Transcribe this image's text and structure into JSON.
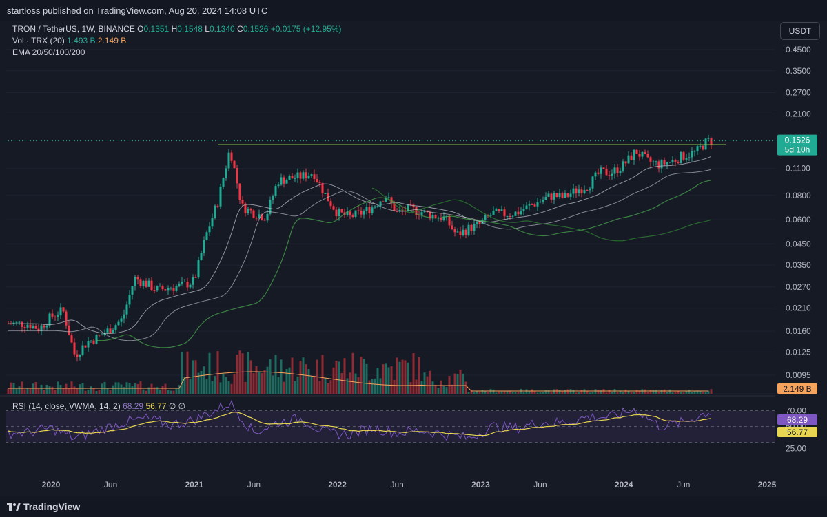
{
  "header": {
    "published": "startloss published on TradingView.com, Aug 20, 2024 14:08 UTC"
  },
  "legend": {
    "symbol": "TRON / TetherUS, 1W, BINANCE",
    "o_label": "O",
    "o_value": "0.1351",
    "h_label": "H",
    "h_value": "0.1548",
    "l_label": "L",
    "l_value": "0.1340",
    "c_label": "C",
    "c_value": "0.1526",
    "change": "+0.0175 (+12.95%)",
    "vol_label": "Vol · TRX (20)",
    "vol_value": "1.493 B",
    "vol_ma": "2.149 B",
    "ema": "EMA 20/50/100/200",
    "rsi_label": "RSI (14, close, VWMA, 14, 2)",
    "rsi_value": "68.29",
    "rsi_ma": "56.77",
    "rsi_extra1": "∅",
    "rsi_extra2": "∅"
  },
  "currency_button": "USDT",
  "footer": {
    "logo_text": "TradingView"
  },
  "colors": {
    "up": "#22ab94",
    "down": "#f23645",
    "ema20": "#b2b5be",
    "ema50": "#d1d4dc",
    "ema100": "#4caf50",
    "ema200": "#2e7d32",
    "rsi": "#7e57c2",
    "rsi_ma": "#e8d552",
    "resistance": "#8bc34a",
    "vol_ma": "#f7a35c"
  },
  "chart_data": {
    "type": "candlestick",
    "symbol": "TRON / TetherUS",
    "interval": "1W",
    "exchange": "BINANCE",
    "y_scale": "log",
    "price_ticks": [
      "0.4500",
      "0.3500",
      "0.2700",
      "0.2100",
      "0.1526",
      "0.1100",
      "0.0800",
      "0.0600",
      "0.0450",
      "0.0350",
      "0.0270",
      "0.0210",
      "0.0160",
      "0.0125",
      "0.0095"
    ],
    "x_ticks": [
      "2020",
      "Jun",
      "2021",
      "Jun",
      "2022",
      "Jun",
      "2023",
      "Jun",
      "2024",
      "Jun",
      "2025"
    ],
    "last_price": "0.1526",
    "countdown": "5d 10h",
    "volume_ma_label": "2.149 B",
    "resistance_level": 0.146,
    "rsi_ticks": [
      "70.00",
      "50.00",
      "25.00"
    ],
    "rsi_last": "68.29",
    "rsi_ma_last": "56.77",
    "series": [
      {
        "name": "price_close",
        "points": [
          [
            "2019-11",
            0.0175
          ],
          [
            "2019-12",
            0.0165
          ],
          [
            "2020-01",
            0.019
          ],
          [
            "2020-02",
            0.0205
          ],
          [
            "2020-03",
            0.012
          ],
          [
            "2020-04",
            0.014
          ],
          [
            "2020-05",
            0.015
          ],
          [
            "2020-06",
            0.0165
          ],
          [
            "2020-07",
            0.0185
          ],
          [
            "2020-08",
            0.03
          ],
          [
            "2020-09",
            0.028
          ],
          [
            "2020-10",
            0.026
          ],
          [
            "2020-11",
            0.027
          ],
          [
            "2020-12",
            0.0275
          ],
          [
            "2021-01",
            0.029
          ],
          [
            "2021-02",
            0.05
          ],
          [
            "2021-03",
            0.075
          ],
          [
            "2021-04",
            0.14
          ],
          [
            "2021-05",
            0.07
          ],
          [
            "2021-06",
            0.065
          ],
          [
            "2021-07",
            0.062
          ],
          [
            "2021-08",
            0.095
          ],
          [
            "2021-09",
            0.098
          ],
          [
            "2021-10",
            0.1
          ],
          [
            "2021-11",
            0.105
          ],
          [
            "2021-12",
            0.08
          ],
          [
            "2022-01",
            0.065
          ],
          [
            "2022-02",
            0.062
          ],
          [
            "2022-03",
            0.065
          ],
          [
            "2022-04",
            0.07
          ],
          [
            "2022-05",
            0.08
          ],
          [
            "2022-06",
            0.065
          ],
          [
            "2022-07",
            0.068
          ],
          [
            "2022-08",
            0.066
          ],
          [
            "2022-09",
            0.063
          ],
          [
            "2022-10",
            0.061
          ],
          [
            "2022-11",
            0.05
          ],
          [
            "2022-12",
            0.054
          ],
          [
            "2023-01",
            0.057
          ],
          [
            "2023-02",
            0.065
          ],
          [
            "2023-03",
            0.064
          ],
          [
            "2023-04",
            0.065
          ],
          [
            "2023-05",
            0.07
          ],
          [
            "2023-06",
            0.075
          ],
          [
            "2023-07",
            0.08
          ],
          [
            "2023-08",
            0.078
          ],
          [
            "2023-09",
            0.085
          ],
          [
            "2023-10",
            0.09
          ],
          [
            "2023-11",
            0.105
          ],
          [
            "2023-12",
            0.105
          ],
          [
            "2024-01",
            0.115
          ],
          [
            "2024-02",
            0.135
          ],
          [
            "2024-03",
            0.12
          ],
          [
            "2024-04",
            0.115
          ],
          [
            "2024-05",
            0.12
          ],
          [
            "2024-06",
            0.128
          ],
          [
            "2024-07",
            0.133
          ],
          [
            "2024-08",
            0.1526
          ]
        ]
      },
      {
        "name": "rsi",
        "points": [
          [
            "2019-11",
            42
          ],
          [
            "2020-01",
            48
          ],
          [
            "2020-03",
            35
          ],
          [
            "2020-05",
            45
          ],
          [
            "2020-07",
            55
          ],
          [
            "2020-09",
            60
          ],
          [
            "2020-11",
            52
          ],
          [
            "2021-01",
            58
          ],
          [
            "2021-03",
            72
          ],
          [
            "2021-04",
            80
          ],
          [
            "2021-06",
            42
          ],
          [
            "2021-08",
            55
          ],
          [
            "2021-10",
            60
          ],
          [
            "2021-12",
            42
          ],
          [
            "2022-02",
            40
          ],
          [
            "2022-04",
            48
          ],
          [
            "2022-06",
            42
          ],
          [
            "2022-08",
            45
          ],
          [
            "2022-10",
            40
          ],
          [
            "2022-12",
            35
          ],
          [
            "2023-02",
            50
          ],
          [
            "2023-04",
            48
          ],
          [
            "2023-06",
            55
          ],
          [
            "2023-08",
            55
          ],
          [
            "2023-10",
            62
          ],
          [
            "2023-12",
            62
          ],
          [
            "2024-02",
            72
          ],
          [
            "2024-04",
            50
          ],
          [
            "2024-06",
            55
          ],
          [
            "2024-08",
            68
          ]
        ]
      }
    ]
  }
}
